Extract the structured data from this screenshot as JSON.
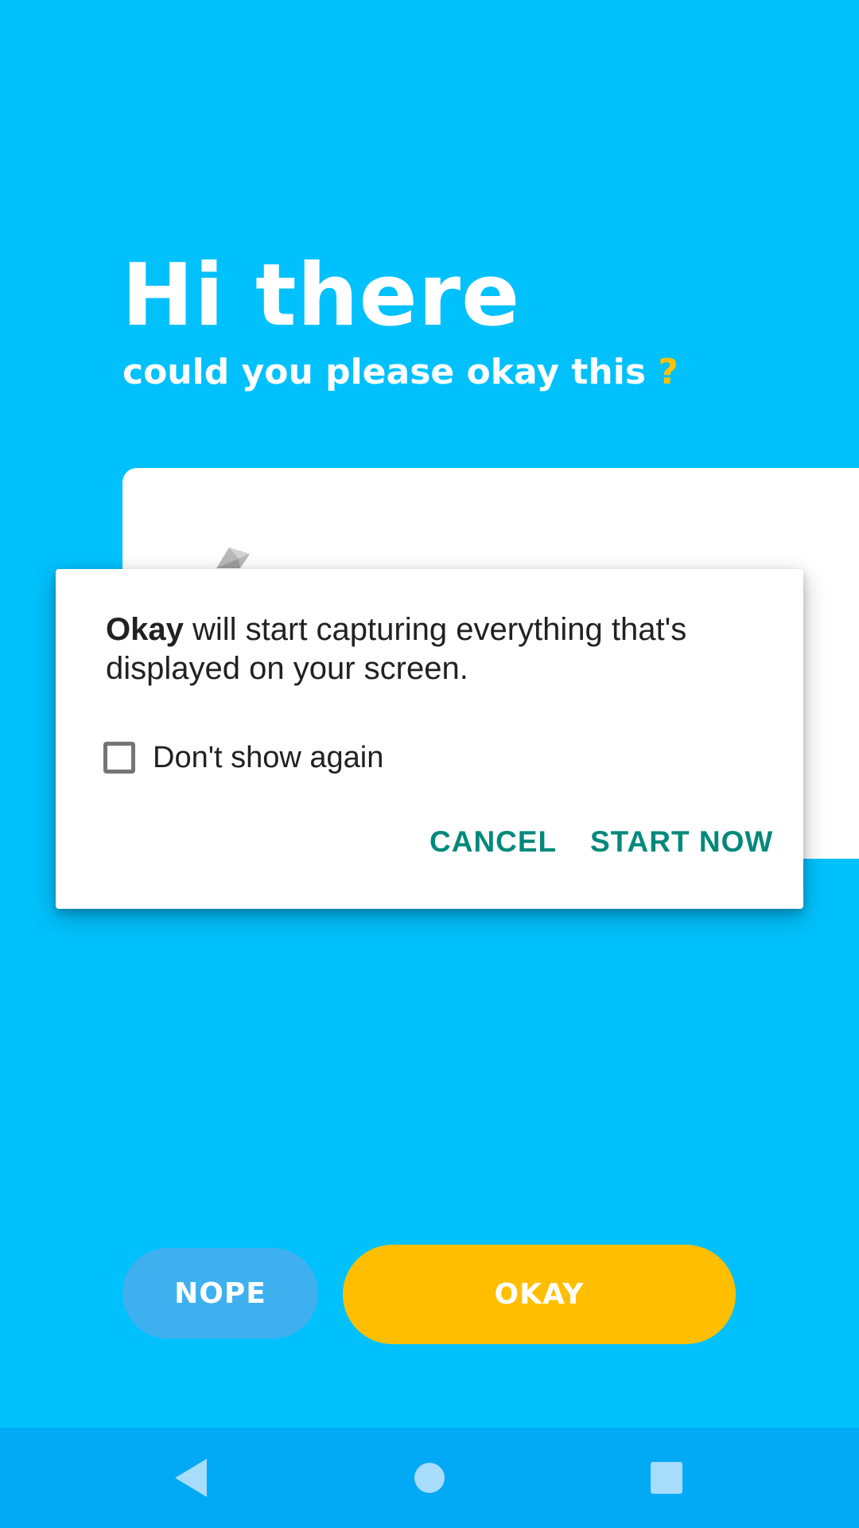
{
  "greeting": {
    "title": "Hi there",
    "subtitle": "could you please okay this",
    "subtitle_mark": "?"
  },
  "dialog": {
    "app_name": "Okay",
    "message": "will start capturing everything that's displayed on your screen.",
    "checkbox_label": "Don't show again",
    "checkbox_checked": false,
    "cancel_label": "CANCEL",
    "start_label": "START NOW"
  },
  "actions": {
    "nope_label": "NOPE",
    "okay_label": "OKAY"
  },
  "navbar": {
    "back_icon": "back-icon",
    "home_icon": "home-icon",
    "recents_icon": "recents-icon"
  },
  "colors": {
    "background": "#00c1fc",
    "accent_yellow": "#ffbf00",
    "dialog_button": "#00897b",
    "nope_button": "#3fb0ef",
    "navbar": "#02a9f4"
  }
}
